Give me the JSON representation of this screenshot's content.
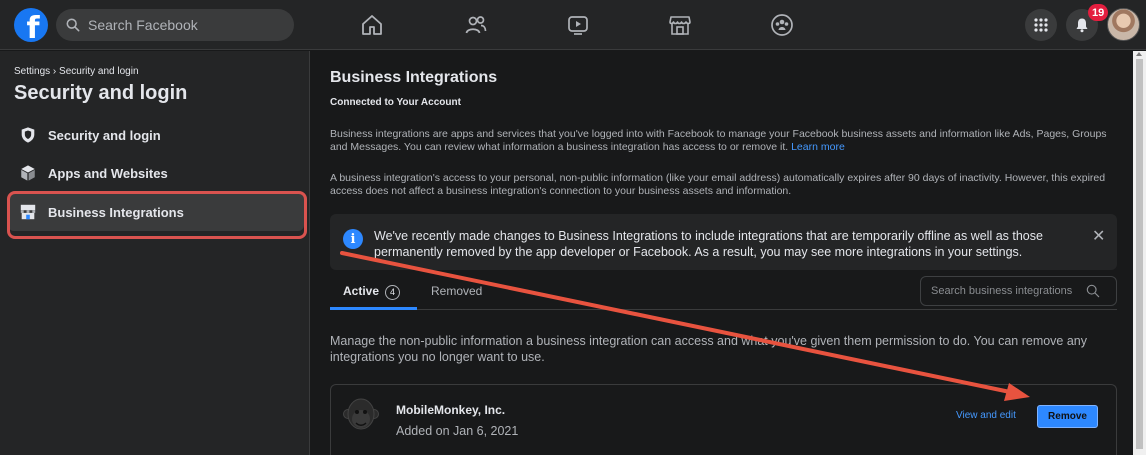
{
  "topbar": {
    "logo_letter": "f",
    "search_placeholder": "Search Facebook",
    "nav_icons": [
      "home-icon",
      "friends-icon",
      "watch-icon",
      "marketplace-icon",
      "groups-icon"
    ],
    "notifications_count": "19"
  },
  "sidebar": {
    "breadcrumb": "Settings › Security and login",
    "title": "Security and login",
    "items": [
      {
        "label": "Security and login",
        "icon": "shield-icon"
      },
      {
        "label": "Apps and Websites",
        "icon": "cube-icon"
      },
      {
        "label": "Business Integrations",
        "icon": "storefront-icon"
      }
    ]
  },
  "main": {
    "title": "Business Integrations",
    "subtitle": "Connected to Your Account",
    "para1": "Business integrations are apps and services that you've logged into with Facebook to manage your Facebook business assets and information like Ads, Pages, Groups and Messages. You can review what information a business integration has access to or remove it.",
    "learn_more": "Learn more",
    "para2": "A business integration's access to your personal, non-public information (like your email address) automatically expires after 90 days of inactivity. However, this expired access does not affect a business integration's connection to your business assets and information.",
    "notice": "We've recently made changes to Business Integrations to include integrations that are temporarily offline as well as those permanently removed by the app developer or Facebook. As a result, you may see more integrations in your settings.",
    "tabs": [
      {
        "label": "Active",
        "count": "4"
      },
      {
        "label": "Removed"
      }
    ],
    "search_placeholder": "Search business integrations",
    "manage_text": "Manage the non-public information a business integration can access and what you've given them permission to do. You can remove any integrations you no longer want to use.",
    "integrations": [
      {
        "name": "MobileMonkey, Inc.",
        "added": "Added on Jan 6, 2021",
        "view_edit": "View and edit",
        "remove": "Remove"
      }
    ]
  },
  "colors": {
    "accent": "#2d88ff",
    "highlight": "#d9534f",
    "background": "#18191a",
    "surface": "#242526"
  }
}
